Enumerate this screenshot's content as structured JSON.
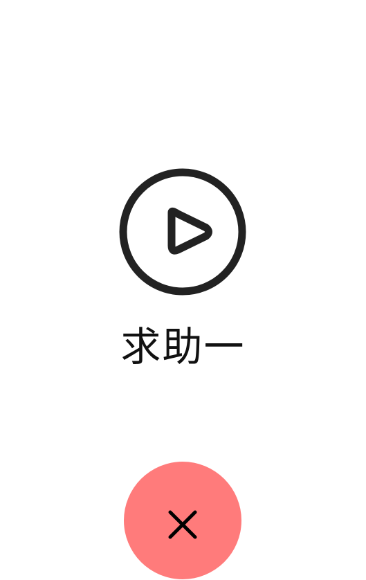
{
  "main": {
    "title": "求助一",
    "play_icon": "play-circle-icon"
  },
  "close": {
    "icon": "close-icon",
    "color": "#ff7b7b"
  }
}
